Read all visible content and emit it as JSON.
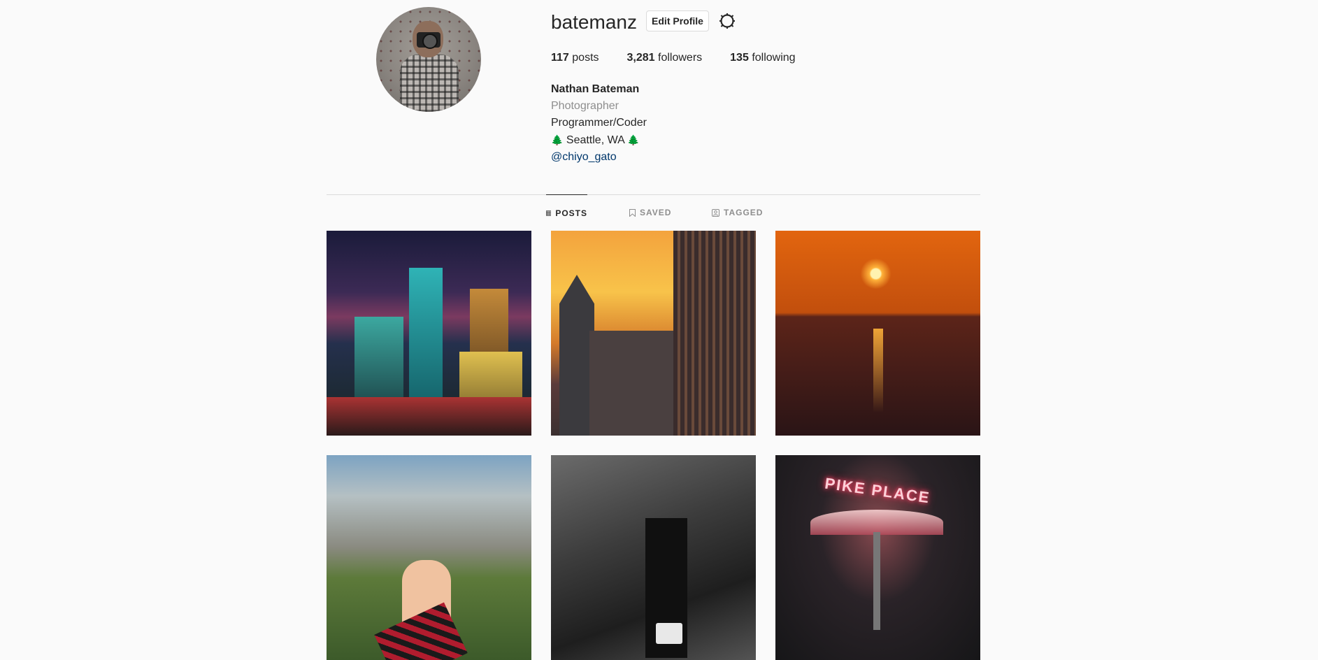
{
  "profile": {
    "username": "batemanz",
    "edit_label": "Edit Profile",
    "stats": {
      "posts_count": "117",
      "posts_label": "posts",
      "followers_count": "3,281",
      "followers_label": "followers",
      "following_count": "135",
      "following_label": "following"
    },
    "bio": {
      "name": "Nathan Bateman",
      "category": "Photographer",
      "line1": "Programmer/Coder",
      "location": "Seattle, WA",
      "tree_emoji": "🌲",
      "mention": "@chiyo_gato"
    }
  },
  "tabs": [
    {
      "label": "POSTS",
      "icon": "grid-icon",
      "active": true
    },
    {
      "label": "SAVED",
      "icon": "bookmark-icon",
      "active": false
    },
    {
      "label": "TAGGED",
      "icon": "tag-person-icon",
      "active": false
    }
  ],
  "posts": {
    "p6_sign": "PIKE PLACE"
  },
  "colors": {
    "background": "#fafafa",
    "text": "#262626",
    "muted": "#8e8e8e",
    "link": "#00376b",
    "border": "#dbdbdb"
  }
}
